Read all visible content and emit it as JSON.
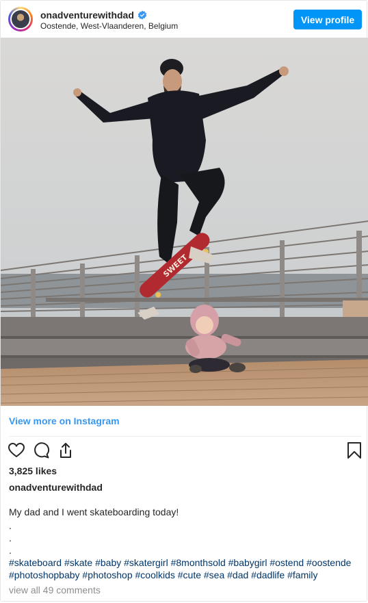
{
  "header": {
    "username": "onadventurewithdad",
    "location": "Oostende, West-Vlaanderen, Belgium",
    "view_profile_label": "View profile"
  },
  "view_more_label": "View more on Instagram",
  "actions": {
    "like_icon": "heart-icon",
    "comment_icon": "comment-icon",
    "share_icon": "share-icon",
    "save_icon": "bookmark-icon"
  },
  "likes_text": "3,825 likes",
  "author": "onadventurewithdad",
  "caption": {
    "text": "My dad and I went skateboarding today!",
    "dots": [
      ".",
      ".",
      "."
    ],
    "hashtags_line1": "#skateboard #skate #baby #skatergirl #8monthsold #babygirl #ostend #oostende",
    "hashtags_line2": "#photoshopbaby #photoshop #coolkids #cute #sea #dad #dadlife #family"
  },
  "comments_link": "view all 49 comments",
  "colors": {
    "brand_blue": "#0095f6",
    "link_blue": "#3897f0",
    "hashtag": "#003569",
    "muted": "#8e8e8e"
  }
}
